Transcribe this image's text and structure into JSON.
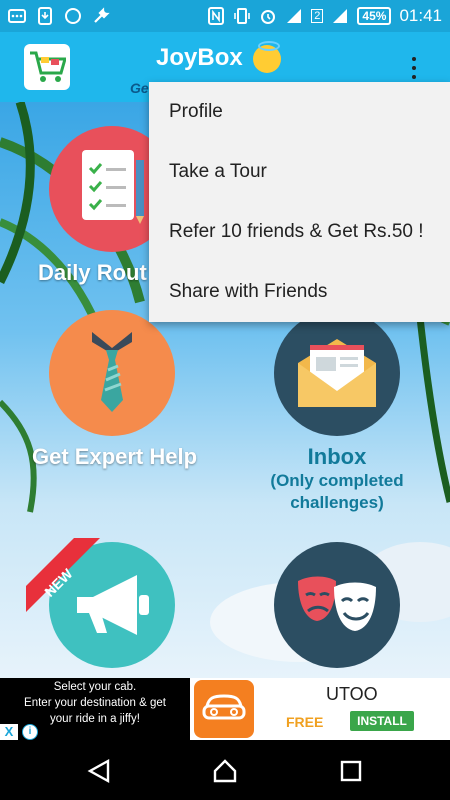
{
  "status_bar": {
    "battery": "45%",
    "time": "01:41",
    "sim_indicator": "2"
  },
  "app_bar": {
    "title": "JoyBox",
    "subtitle": "Ge",
    "overflow_icon": "more-vert-icon"
  },
  "tiles": [
    {
      "label": "Daily Rout",
      "icon": "checklist-icon",
      "color": "#e8505b"
    },
    {
      "label": "Get Expert Help",
      "icon": "necktie-icon",
      "color": "#f58b4c"
    },
    {
      "label": "Inbox",
      "sub1": "(Only completed",
      "sub2": "challenges)",
      "icon": "envelope-icon",
      "color": "#2c4e62"
    },
    {
      "label": "",
      "badge": "NEW",
      "icon": "megaphone-icon",
      "color": "#3fc1c0"
    },
    {
      "label": "",
      "icon": "theater-masks-icon",
      "color": "#2c4e62"
    }
  ],
  "menu": {
    "items": [
      "Profile",
      "Take a Tour",
      "Refer 10 friends & Get Rs.50 !",
      "Share with Friends"
    ]
  },
  "ad": {
    "line1": "Select your cab.",
    "line2": "Enter your destination & get",
    "line3": "your ride in a jiffy!",
    "brand": "UTOO",
    "price": "FREE",
    "cta": "INSTALL",
    "close": "X",
    "info": "i"
  }
}
